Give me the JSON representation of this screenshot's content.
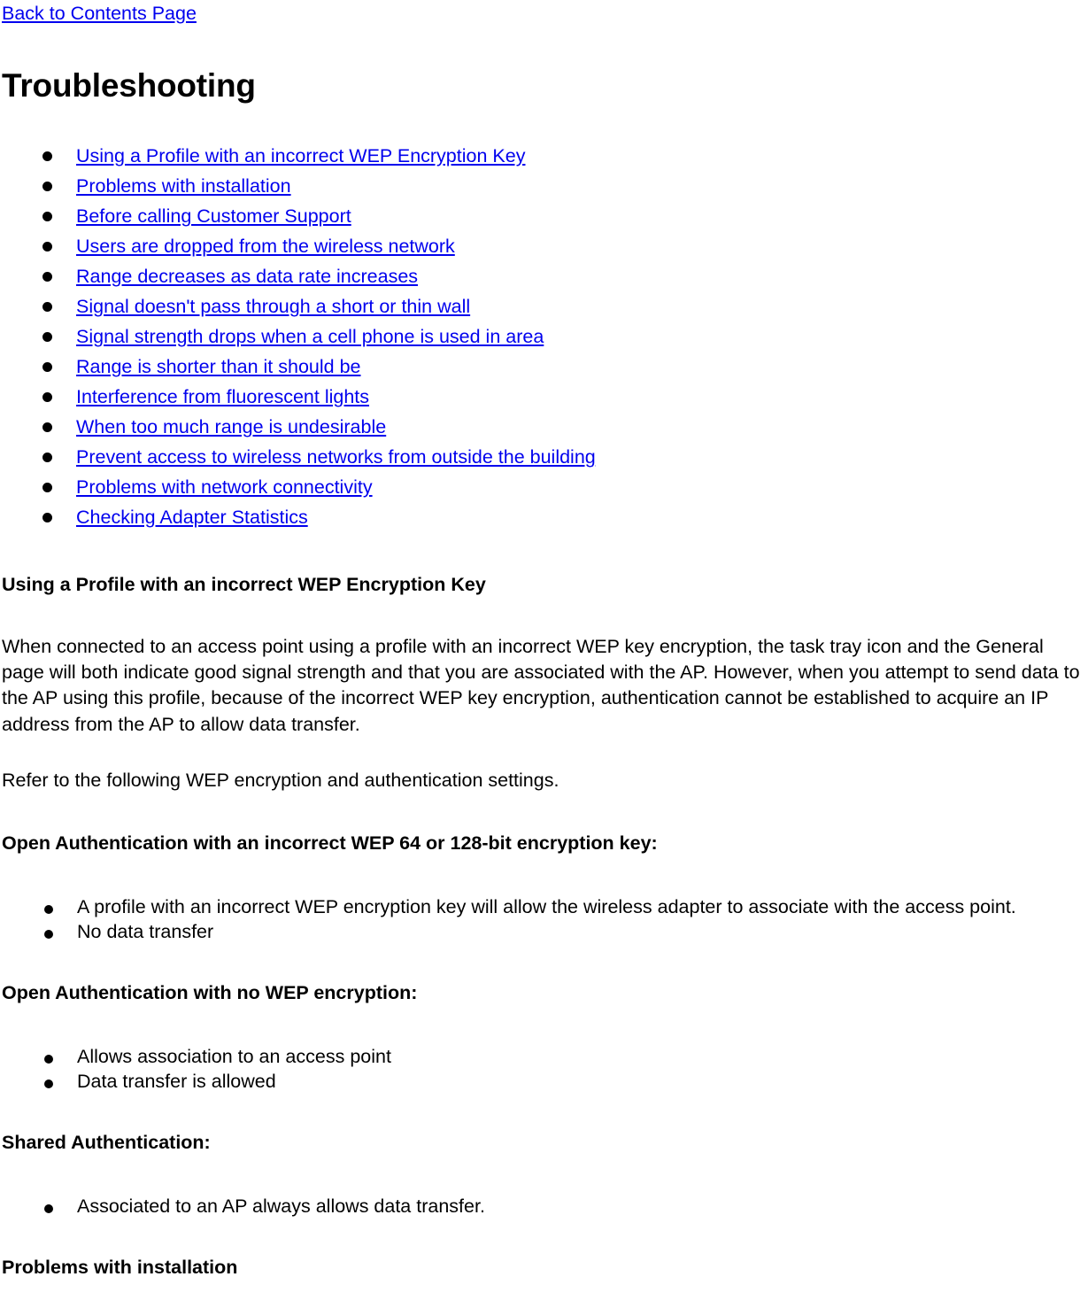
{
  "nav": {
    "back_link": "Back to Contents Page"
  },
  "page_title": "Troubleshooting",
  "toc": {
    "items": [
      {
        "label": "Using a Profile with an incorrect WEP Encryption Key"
      },
      {
        "label": "Problems with installation"
      },
      {
        "label": "Before calling Customer Support"
      },
      {
        "label": "Users are dropped from the wireless network"
      },
      {
        "label": "Range decreases as data rate increases"
      },
      {
        "label": "Signal doesn't pass through a short or thin wall"
      },
      {
        "label": "Signal strength drops when a cell phone is used in area"
      },
      {
        "label": "Range is shorter than it should be"
      },
      {
        "label": "Interference from fluorescent lights"
      },
      {
        "label": "When too much range is undesirable"
      },
      {
        "label": "Prevent access to wireless networks from outside the building"
      },
      {
        "label": "Problems with network connectivity"
      },
      {
        "label": "Checking Adapter Statistics"
      }
    ]
  },
  "sections": {
    "wep_key": {
      "heading": "Using a Profile with an incorrect WEP Encryption Key",
      "paragraph": "When connected to an access point using a profile with an incorrect WEP key encryption, the task tray icon and the General page will both indicate good signal strength and that you are associated with the AP. However, when you attempt to send data to the AP using this profile, because of the incorrect WEP key encryption, authentication cannot be established to acquire an IP address from the AP to allow data transfer.",
      "refer_text": "Refer to the following WEP encryption and authentication settings."
    },
    "open_auth_incorrect": {
      "heading": "Open Authentication with an incorrect WEP 64 or 128-bit encryption key:",
      "bullets": [
        "A profile with an incorrect WEP encryption key will allow the wireless adapter to associate with the access point.",
        "No data transfer"
      ]
    },
    "open_auth_no_wep": {
      "heading": "Open Authentication with no WEP encryption:",
      "bullets": [
        "Allows association to an access point",
        "Data transfer is allowed"
      ]
    },
    "shared_auth": {
      "heading": "Shared Authentication:",
      "bullets": [
        "Associated to an AP always allows data transfer."
      ]
    },
    "problems_install": {
      "heading": "Problems with installation"
    }
  },
  "colors": {
    "link": "#0000EE",
    "text": "#000000",
    "background": "#FFFFFF"
  }
}
